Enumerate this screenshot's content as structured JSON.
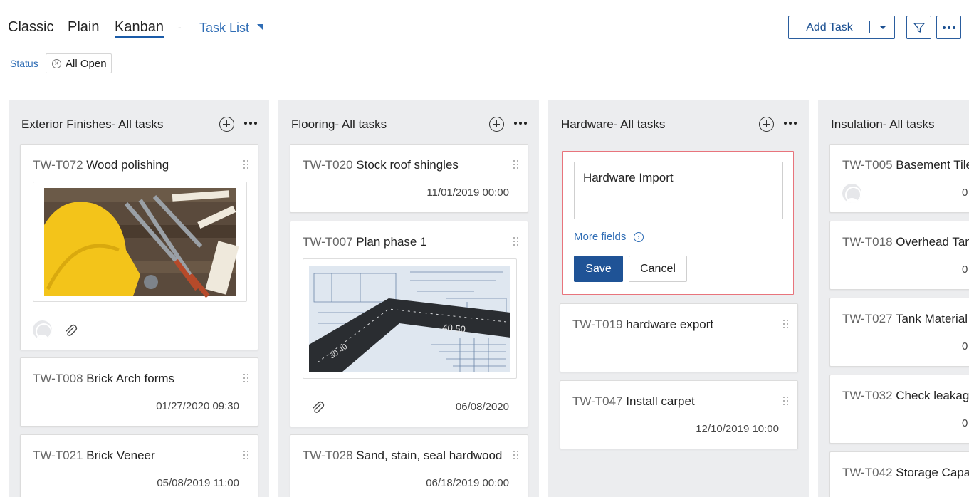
{
  "views": {
    "classic": "Classic",
    "plain": "Plain",
    "kanban": "Kanban",
    "separator": "-",
    "task_list": "Task List"
  },
  "toolbar": {
    "add_task": "Add Task",
    "filter_icon": "filter-icon",
    "more_icon": "more-icon"
  },
  "filter": {
    "label": "Status",
    "chip": "All Open"
  },
  "colors": {
    "accent": "#2f6db5",
    "primary_button": "#1f5396",
    "column_bg": "#ecedef",
    "form_border": "#e8747c"
  },
  "columns": [
    {
      "title": "Exterior Finishes- All tasks",
      "cards": [
        {
          "id": "TW-T072",
          "name": "Wood polishing",
          "image": "tools-and-hard-hat",
          "has_avatar": true,
          "has_attachment": true
        },
        {
          "id": "TW-T008",
          "name": "Brick Arch forms",
          "date": "01/27/2020 09:30"
        },
        {
          "id": "TW-T021",
          "name": "Brick Veneer",
          "date": "05/08/2019 11:00"
        }
      ]
    },
    {
      "title": "Flooring- All tasks",
      "cards": [
        {
          "id": "TW-T020",
          "name": "Stock roof shingles",
          "date": "11/01/2019 00:00"
        },
        {
          "id": "TW-T007",
          "name": "Plan phase 1",
          "image": "blueprint-with-ruler",
          "has_attachment": true,
          "date": "06/08/2020"
        },
        {
          "id": "TW-T028",
          "name": "Sand, stain, seal hardwood",
          "date": "06/18/2019 00:00"
        }
      ]
    },
    {
      "title": "Hardware- All tasks",
      "form": {
        "input_value": "Hardware Import",
        "more_fields": "More fields",
        "save": "Save",
        "cancel": "Cancel"
      },
      "cards": [
        {
          "id": "TW-T019",
          "name": "hardware export"
        },
        {
          "id": "TW-T047",
          "name": "Install carpet",
          "date": "12/10/2019 10:00"
        }
      ]
    },
    {
      "title": "Insulation- All tasks",
      "cards": [
        {
          "id": "TW-T005",
          "name": "Basement Tile",
          "has_avatar": true,
          "date_fragment": "0"
        },
        {
          "id": "TW-T018",
          "name": "Overhead Tan",
          "date_fragment": "0"
        },
        {
          "id": "TW-T027",
          "name": "Tank Material",
          "date_fragment": "0"
        },
        {
          "id": "TW-T032",
          "name": "Check leakage",
          "date_fragment": "0"
        },
        {
          "id": "TW-T042",
          "name": "Storage Capac"
        }
      ]
    }
  ]
}
